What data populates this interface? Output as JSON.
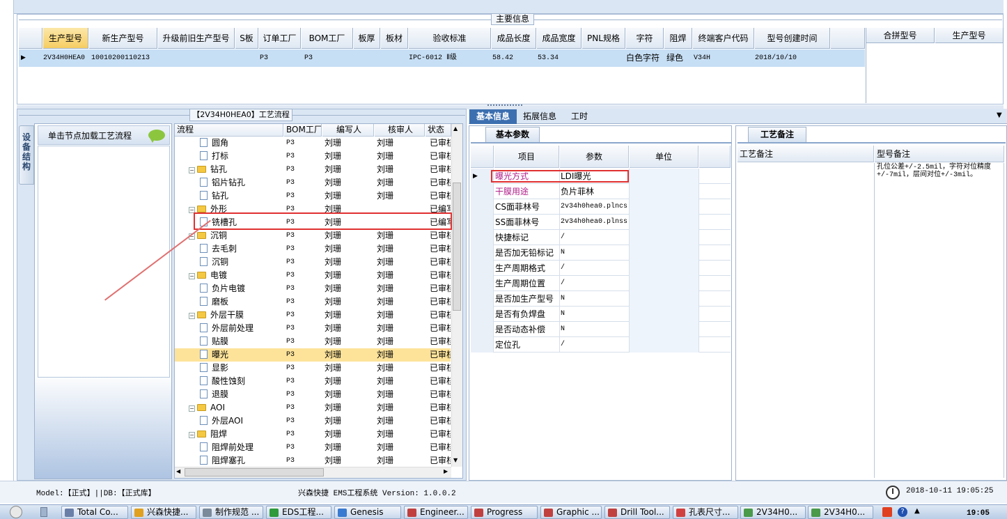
{
  "main": {
    "section_title": "主要信息",
    "columns": [
      "生产型号",
      "新生产型号",
      "升级前旧生产型号",
      "S板",
      "订单工厂",
      "BOM工厂",
      "板厚",
      "板材",
      "验收标准",
      "成品长度",
      "成品宽度",
      "PNL规格",
      "字符",
      "阻焊",
      "终端客户代码",
      "型号创建时间"
    ],
    "row": [
      "2V34H0HEA0",
      "10010200110213",
      "",
      "",
      "P3",
      "P3",
      "",
      "",
      "IPC-6012 Ⅱ级",
      "58.42",
      "53.34",
      "",
      "白色字符",
      "绿色",
      "V34H",
      "2018/10/10"
    ],
    "side_columns": [
      "合拼型号",
      "生产型号"
    ]
  },
  "left": {
    "panel_title": "【2V34H0HEA0】工艺流程",
    "vertical_tab": "设备结构",
    "node_hint": "单击节点加载工艺流程",
    "tree_columns": [
      "流程",
      "BOM工厂",
      "编写人",
      "核审人",
      "状态"
    ],
    "tree_rows": [
      {
        "name": "圆角",
        "level": 2,
        "type": "doc",
        "bom": "P3",
        "writer": "刘珊",
        "reviewer": "刘珊",
        "status": "已审核"
      },
      {
        "name": "打标",
        "level": 2,
        "type": "doc",
        "bom": "P3",
        "writer": "刘珊",
        "reviewer": "刘珊",
        "status": "已审核"
      },
      {
        "name": "钻孔",
        "level": 1,
        "type": "folder",
        "bom": "P3",
        "writer": "刘珊",
        "reviewer": "刘珊",
        "status": "已审核"
      },
      {
        "name": "铝片钻孔",
        "level": 2,
        "type": "doc",
        "bom": "P3",
        "writer": "刘珊",
        "reviewer": "刘珊",
        "status": "已审核"
      },
      {
        "name": "钻孔",
        "level": 2,
        "type": "doc",
        "bom": "P3",
        "writer": "刘珊",
        "reviewer": "刘珊",
        "status": "已审核"
      },
      {
        "name": "外形",
        "level": 1,
        "type": "folder",
        "bom": "P3",
        "writer": "刘珊",
        "reviewer": "",
        "status": "已编写"
      },
      {
        "name": "铣槽孔",
        "level": 2,
        "type": "doc",
        "bom": "P3",
        "writer": "刘珊",
        "reviewer": "",
        "status": "已编写"
      },
      {
        "name": "沉铜",
        "level": 1,
        "type": "folder",
        "bom": "P3",
        "writer": "刘珊",
        "reviewer": "刘珊",
        "status": "已审核"
      },
      {
        "name": "去毛刺",
        "level": 2,
        "type": "doc",
        "bom": "P3",
        "writer": "刘珊",
        "reviewer": "刘珊",
        "status": "已审核"
      },
      {
        "name": "沉铜",
        "level": 2,
        "type": "doc",
        "bom": "P3",
        "writer": "刘珊",
        "reviewer": "刘珊",
        "status": "已审核"
      },
      {
        "name": "电镀",
        "level": 1,
        "type": "folder",
        "bom": "P3",
        "writer": "刘珊",
        "reviewer": "刘珊",
        "status": "已审核"
      },
      {
        "name": "负片电镀",
        "level": 2,
        "type": "doc",
        "bom": "P3",
        "writer": "刘珊",
        "reviewer": "刘珊",
        "status": "已审核"
      },
      {
        "name": "磨板",
        "level": 2,
        "type": "doc",
        "bom": "P3",
        "writer": "刘珊",
        "reviewer": "刘珊",
        "status": "已审核"
      },
      {
        "name": "外层干膜",
        "level": 1,
        "type": "folder",
        "bom": "P3",
        "writer": "刘珊",
        "reviewer": "刘珊",
        "status": "已审核"
      },
      {
        "name": "外层前处理",
        "level": 2,
        "type": "doc",
        "bom": "P3",
        "writer": "刘珊",
        "reviewer": "刘珊",
        "status": "已审核"
      },
      {
        "name": "贴膜",
        "level": 2,
        "type": "doc",
        "bom": "P3",
        "writer": "刘珊",
        "reviewer": "刘珊",
        "status": "已审核"
      },
      {
        "name": "曝光",
        "level": 2,
        "type": "doc",
        "bom": "P3",
        "writer": "刘珊",
        "reviewer": "刘珊",
        "status": "已审核",
        "selected": true
      },
      {
        "name": "显影",
        "level": 2,
        "type": "doc",
        "bom": "P3",
        "writer": "刘珊",
        "reviewer": "刘珊",
        "status": "已审核"
      },
      {
        "name": "酸性蚀刻",
        "level": 2,
        "type": "doc",
        "bom": "P3",
        "writer": "刘珊",
        "reviewer": "刘珊",
        "status": "已审核"
      },
      {
        "name": "退膜",
        "level": 2,
        "type": "doc",
        "bom": "P3",
        "writer": "刘珊",
        "reviewer": "刘珊",
        "status": "已审核"
      },
      {
        "name": "AOI",
        "level": 1,
        "type": "folder",
        "bom": "P3",
        "writer": "刘珊",
        "reviewer": "刘珊",
        "status": "已审核"
      },
      {
        "name": "外层AOI",
        "level": 2,
        "type": "doc",
        "bom": "P3",
        "writer": "刘珊",
        "reviewer": "刘珊",
        "status": "已审核"
      },
      {
        "name": "阻焊",
        "level": 1,
        "type": "folder",
        "bom": "P3",
        "writer": "刘珊",
        "reviewer": "刘珊",
        "status": "已审核"
      },
      {
        "name": "阻焊前处理",
        "level": 2,
        "type": "doc",
        "bom": "P3",
        "writer": "刘珊",
        "reviewer": "刘珊",
        "status": "已审核"
      },
      {
        "name": "阻焊塞孔",
        "level": 2,
        "type": "doc",
        "bom": "P3",
        "writer": "刘珊",
        "reviewer": "刘珊",
        "status": "已审核"
      }
    ]
  },
  "right": {
    "tabs": [
      "基本信息",
      "拓展信息",
      "工时"
    ],
    "basic_tab": "基本参数",
    "param_columns": [
      "项目",
      "参数",
      "单位"
    ],
    "params": [
      {
        "item": "曝光方式",
        "value": "LDI曝光",
        "unit": "",
        "color": "#b0208a"
      },
      {
        "item": "干膜用途",
        "value": "负片菲林",
        "unit": "",
        "color": "#b0208a"
      },
      {
        "item": "CS面菲林号",
        "value": "2v34h0hea0.plncs",
        "unit": ""
      },
      {
        "item": "SS面菲林号",
        "value": "2v34h0hea0.plnss",
        "unit": ""
      },
      {
        "item": "快捷标记",
        "value": "/",
        "unit": ""
      },
      {
        "item": "是否加无铅标记",
        "value": "N",
        "unit": ""
      },
      {
        "item": "生产周期格式",
        "value": "/",
        "unit": ""
      },
      {
        "item": "生产周期位置",
        "value": "/",
        "unit": ""
      },
      {
        "item": "是否加生产型号",
        "value": "N",
        "unit": ""
      },
      {
        "item": "是否有负焊盘",
        "value": "N",
        "unit": ""
      },
      {
        "item": "是否动态补偿",
        "value": "N",
        "unit": ""
      },
      {
        "item": "定位孔",
        "value": "/",
        "unit": ""
      }
    ],
    "craft_tab": "工艺备注",
    "craft_columns": [
      "工艺备注",
      "型号备注"
    ],
    "model_note": "孔位公差+/-2.5mil，字符对位精度+/-7mil，层间对位+/-3mil。"
  },
  "status": {
    "model": "Model:【正式】||DB:【正式库】",
    "system": "兴森快捷 EMS工程系统 Version: 1.0.0.2",
    "datetime": "2018-10-11 19:05:25"
  },
  "taskbar": {
    "items": [
      "Total Co...",
      "兴森快捷...",
      "制作规范 ...",
      "EDS工程...",
      "Genesis",
      "Engineer...",
      "Progress",
      "Graphic ...",
      "Drill Tool...",
      "孔表尺寸...",
      "2V34H0...",
      "2V34H0..."
    ],
    "time": "19:05"
  },
  "colors": {
    "accent": "#3c6fb0",
    "highlight": "#fde39a",
    "selected_header": "#f6cd62",
    "row_select": "#c7dff5",
    "annotation_red": "#e03030"
  }
}
